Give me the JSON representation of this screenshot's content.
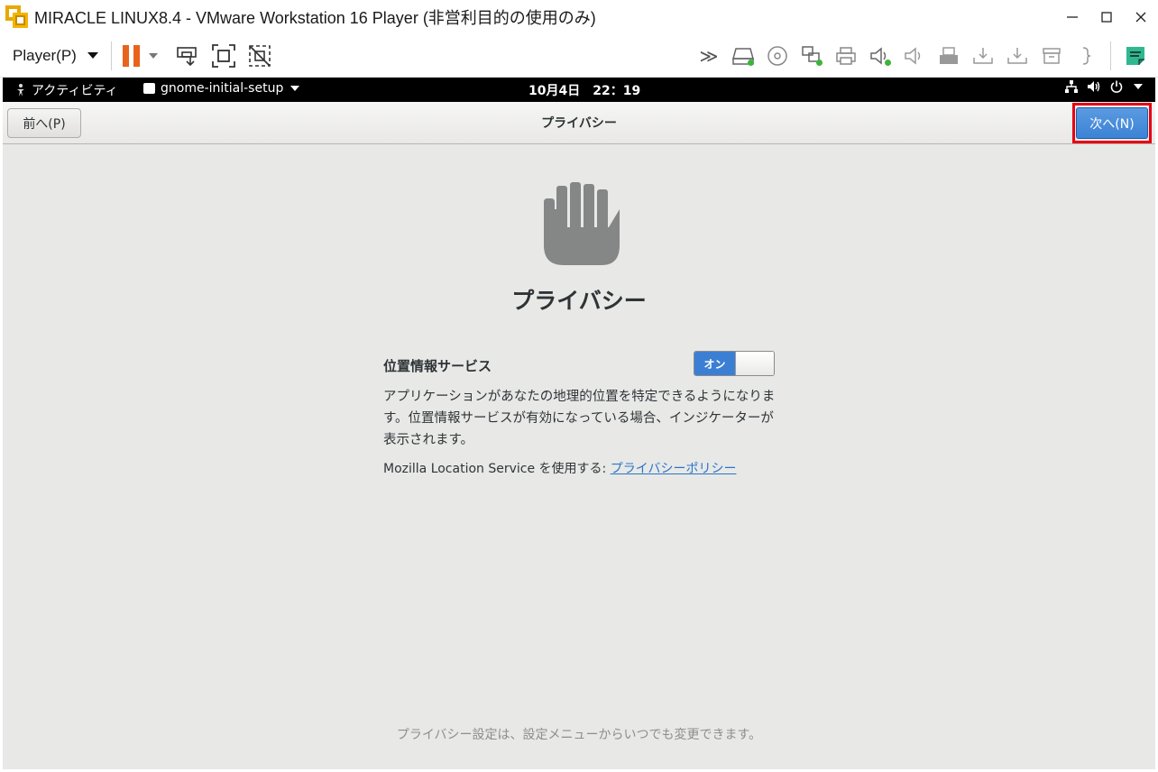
{
  "window": {
    "title": "MIRACLE LINUX8.4 - VMware Workstation 16 Player (非営利目的の使用のみ)",
    "minimize": "—",
    "maximize": "☐",
    "close": "✕"
  },
  "toolbar": {
    "player_menu": "Player(P)",
    "more_label": "≫",
    "accent": "#e8631c"
  },
  "gnome_bar": {
    "activities": "アクティビティ",
    "app_name": "gnome-initial-setup",
    "clock": "10月4日　22：19"
  },
  "setup": {
    "prev_button": "前へ(P)",
    "header_title": "プライバシー",
    "next_button": "次へ(N)",
    "heading": "プライバシー",
    "location_label": "位置情報サービス",
    "switch_on_label": "オン",
    "description": "アプリケーションがあなたの地理的位置を特定できるようになります。位置情報サービスが有効になっている場合、インジケーターが表示されます。",
    "mozilla_prefix": "Mozilla Location Service を使用する: ",
    "privacy_policy_link": "プライバシーポリシー",
    "footer": "プライバシー設定は、設定メニューからいつでも変更できます。",
    "highlight_color": "#e60012",
    "primary_color": "#3b7fd4"
  }
}
